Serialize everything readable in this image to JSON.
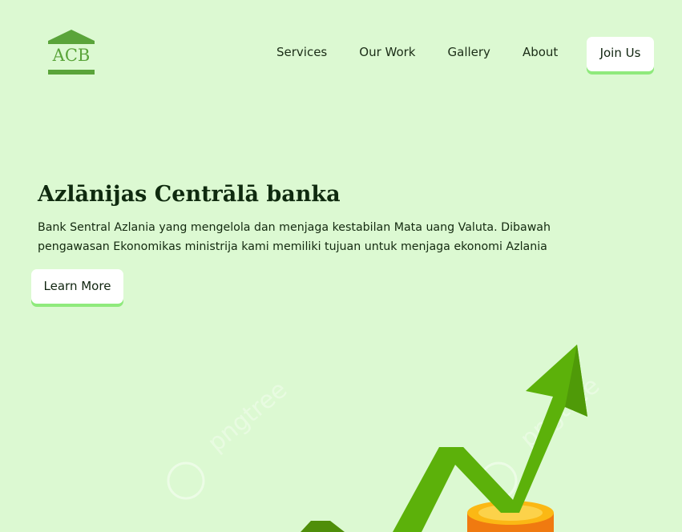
{
  "header": {
    "logo_text": "ACB",
    "nav": [
      "Services",
      "Our Work",
      "Gallery",
      "About"
    ],
    "cta_label": "Join Us"
  },
  "hero": {
    "title": "Azlānijas Centrālā banka",
    "description_line1": "Bank Sentral Azlania yang mengelola dan menjaga kestabilan Mata uang Valuta. Dibawah",
    "description_line2": "pengawasan Ekonomikas ministrija kami memiliki tujuan untuk menjaga ekonomi Azlania",
    "button_label": "Learn More"
  },
  "illustration": {
    "icon": "growth-arrow-coins-icon",
    "watermark": "pngtree"
  },
  "colors": {
    "background": "#dcf9d2",
    "accent": "#8fea7c",
    "logo": "#5aa43a",
    "arrow": "#5cb10a",
    "coin": "#fbb814"
  }
}
